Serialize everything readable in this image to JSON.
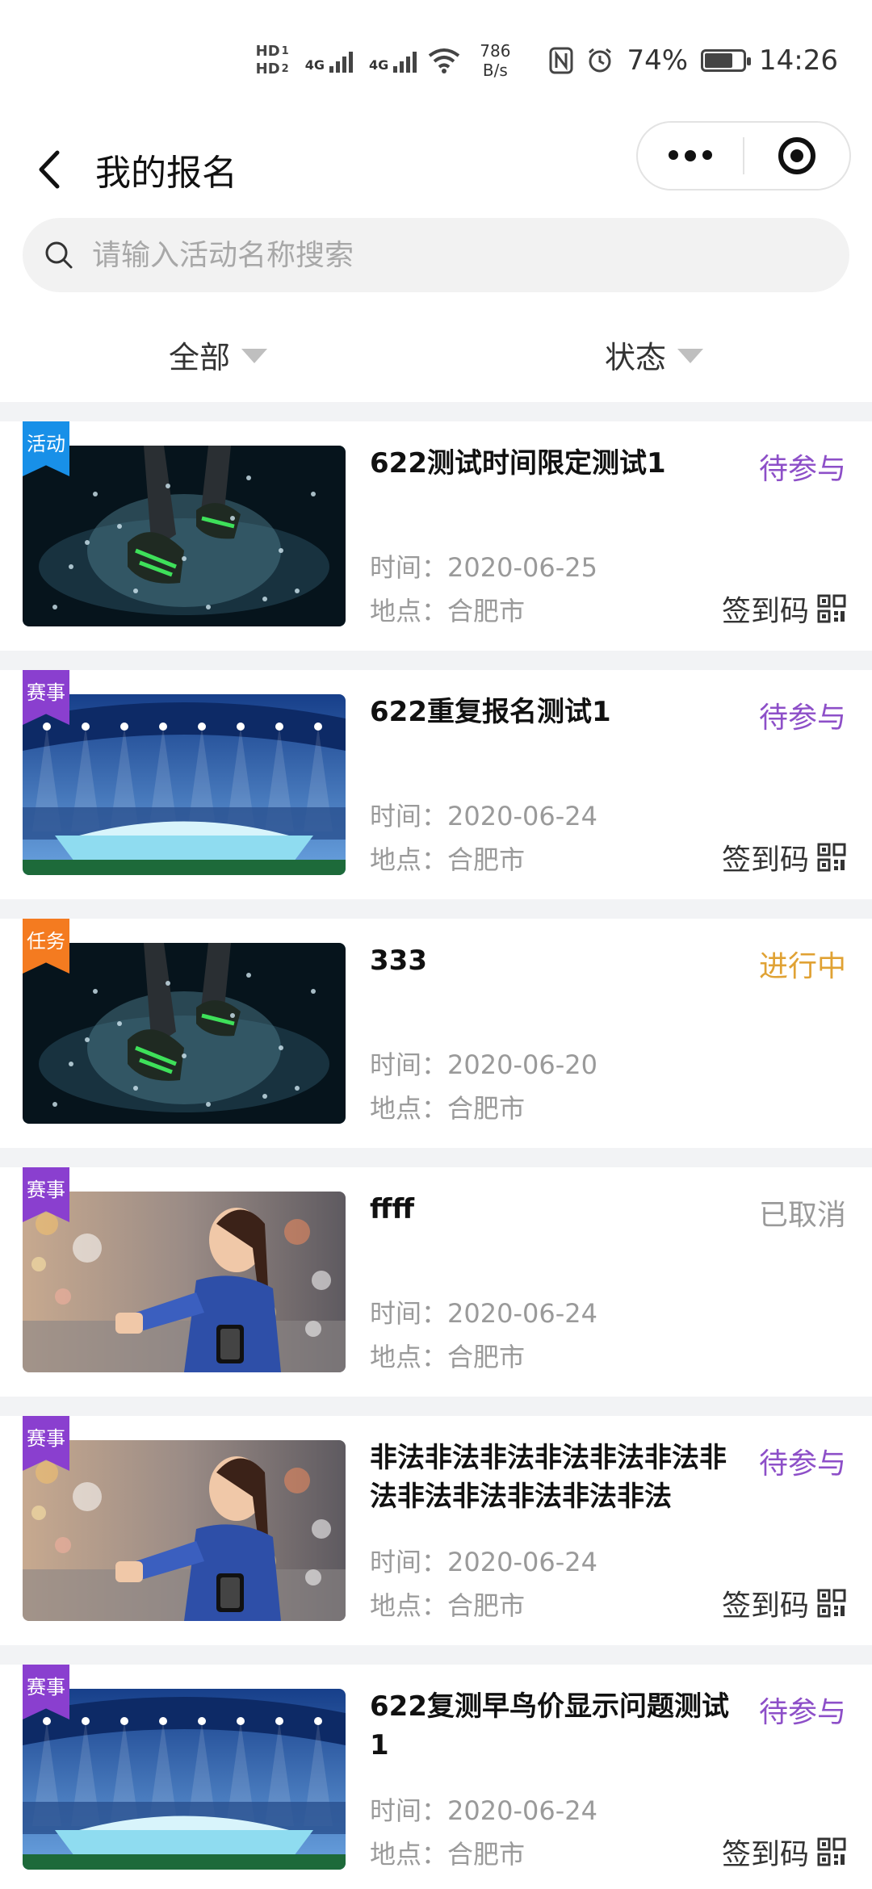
{
  "status_bar": {
    "hd1": "HD",
    "hd1_sub": "1",
    "hd2": "HD",
    "hd2_sub": "2",
    "net1": "4G",
    "net2": "4G",
    "speed_value": "786",
    "speed_unit": "B/s",
    "battery": "74%",
    "battery_level": 0.74,
    "time": "14:26"
  },
  "nav": {
    "title": "我的报名"
  },
  "search": {
    "placeholder": "请输入活动名称搜索"
  },
  "filters": [
    {
      "label": "全部"
    },
    {
      "label": "状态"
    }
  ],
  "labels": {
    "time_prefix": "时间：",
    "place_prefix": "地点：",
    "checkin": "签到码"
  },
  "items": [
    {
      "tag": "活动",
      "tag_color": "#1890e8",
      "title": "622测试时间限定测试1",
      "status": "待参与",
      "status_color": "#8d4fc8",
      "time": "2020-06-25",
      "place": "合肥市",
      "has_checkin": true,
      "image": "splash"
    },
    {
      "tag": "赛事",
      "tag_color": "#8a3fcf",
      "title": "622重复报名测试1",
      "status": "待参与",
      "status_color": "#8d4fc8",
      "time": "2020-06-24",
      "place": "合肥市",
      "has_checkin": true,
      "image": "stadium"
    },
    {
      "tag": "任务",
      "tag_color": "#f47b20",
      "title": "333",
      "status": "进行中",
      "status_color": "#e0a234",
      "time": "2020-06-20",
      "place": "合肥市",
      "has_checkin": false,
      "image": "splash"
    },
    {
      "tag": "赛事",
      "tag_color": "#8a3fcf",
      "title": "ffff",
      "status": "已取消",
      "status_color": "#9a9a9a",
      "time": "2020-06-24",
      "place": "合肥市",
      "has_checkin": false,
      "image": "runner"
    },
    {
      "tag": "赛事",
      "tag_color": "#8a3fcf",
      "title": "非法非法非法非法非法非法非法非法非法非法非法非法",
      "status": "待参与",
      "status_color": "#8d4fc8",
      "time": "2020-06-24",
      "place": "合肥市",
      "has_checkin": true,
      "image": "runner"
    },
    {
      "tag": "赛事",
      "tag_color": "#8a3fcf",
      "title": "622复测早鸟价显示问题测试1",
      "status": "待参与",
      "status_color": "#8d4fc8",
      "time": "2020-06-24",
      "place": "合肥市",
      "has_checkin": true,
      "image": "stadium"
    }
  ]
}
